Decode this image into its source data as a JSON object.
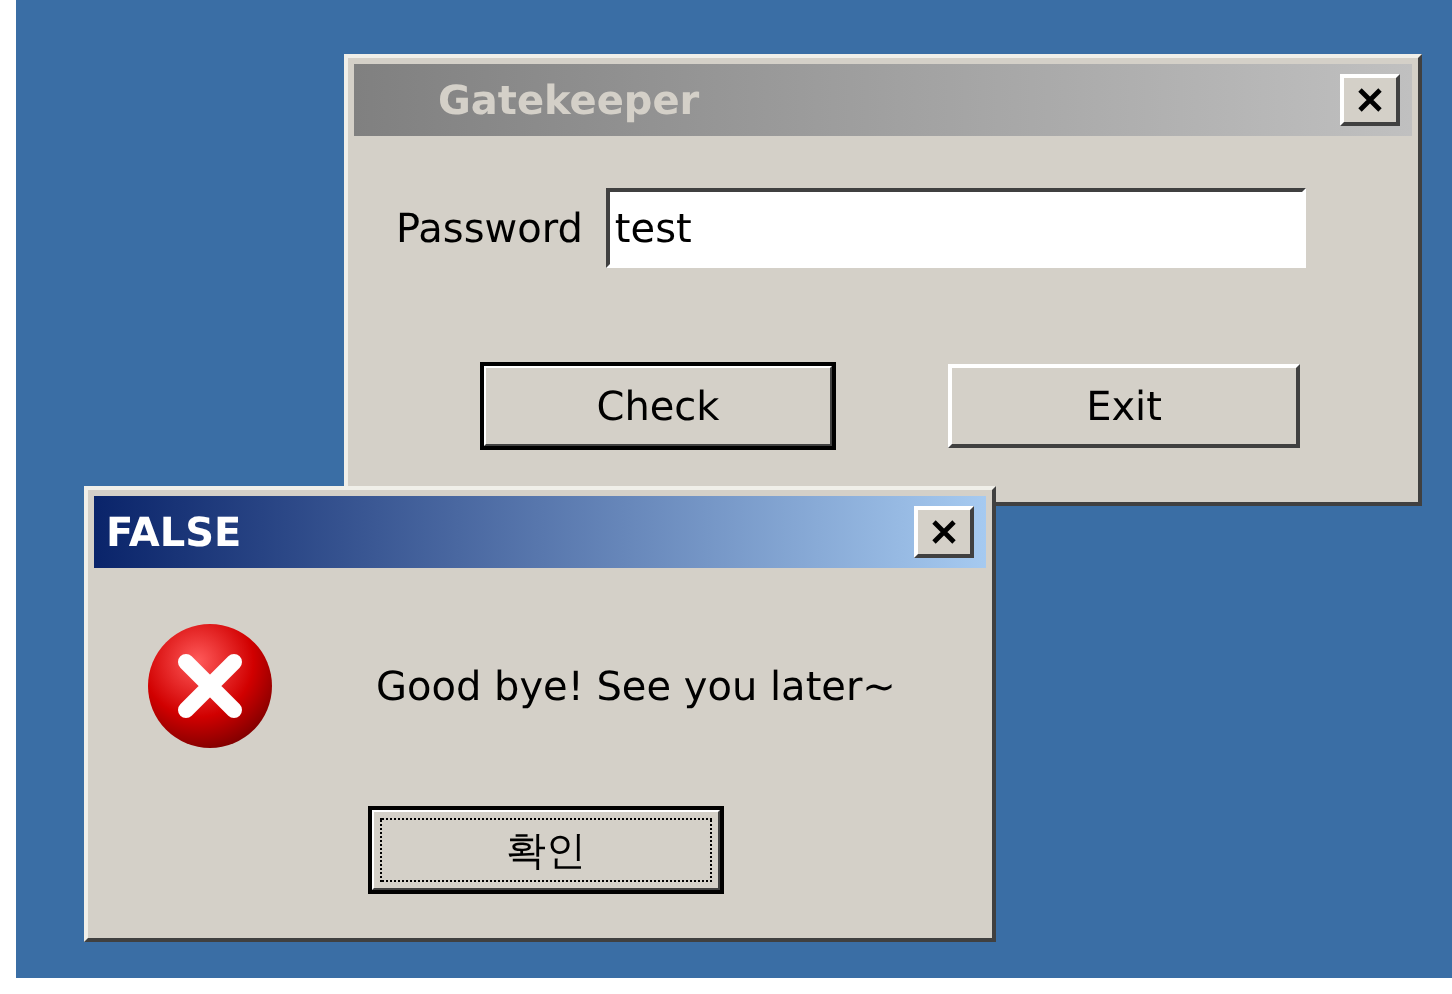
{
  "main_window": {
    "title": "Gatekeeper",
    "active": false,
    "field": {
      "label": "Password",
      "value": "test"
    },
    "buttons": [
      {
        "label": "Check",
        "default": true,
        "focused": false
      },
      {
        "label": "Exit",
        "default": false,
        "focused": false
      }
    ]
  },
  "message_box": {
    "title": "FALSE",
    "active": true,
    "message": "Good bye! See you later~",
    "buttons": [
      {
        "label": "확인",
        "default": true,
        "focused": true
      }
    ]
  }
}
